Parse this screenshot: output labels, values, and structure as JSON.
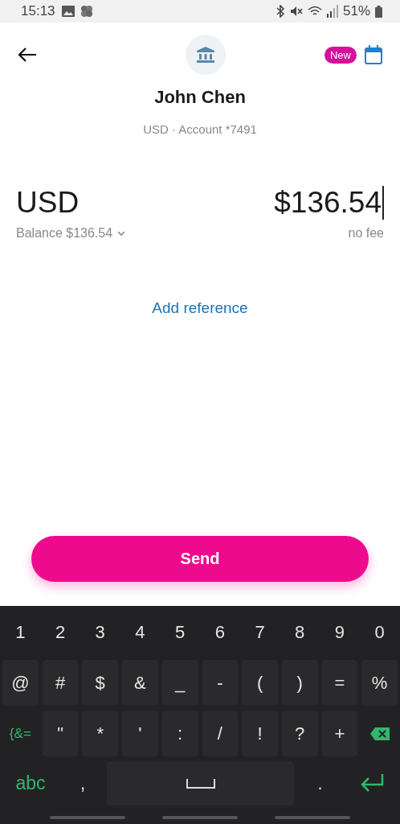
{
  "status_bar": {
    "time": "15:13",
    "battery": "51%"
  },
  "header": {
    "badge": "New"
  },
  "recipient": {
    "name": "John Chen",
    "account": "USD · Account *7491"
  },
  "amount": {
    "currency": "USD",
    "value": "$136.54",
    "balance": "Balance $136.54",
    "fee": "no fee"
  },
  "add_reference": "Add reference",
  "send_button": "Send",
  "keyboard": {
    "rows": [
      [
        {
          "kind": "plain",
          "label": "1"
        },
        {
          "kind": "plain",
          "label": "2"
        },
        {
          "kind": "plain",
          "label": "3"
        },
        {
          "kind": "plain",
          "label": "4"
        },
        {
          "kind": "plain",
          "label": "5"
        },
        {
          "kind": "plain",
          "label": "6"
        },
        {
          "kind": "plain",
          "label": "7"
        },
        {
          "kind": "plain",
          "label": "8"
        },
        {
          "kind": "plain",
          "label": "9"
        },
        {
          "kind": "plain",
          "label": "0"
        }
      ],
      [
        {
          "kind": "key",
          "label": "@"
        },
        {
          "kind": "key",
          "label": "#"
        },
        {
          "kind": "key",
          "label": "$"
        },
        {
          "kind": "key",
          "label": "&"
        },
        {
          "kind": "key",
          "label": "_"
        },
        {
          "kind": "key",
          "label": "-"
        },
        {
          "kind": "key",
          "label": "("
        },
        {
          "kind": "key",
          "label": ")"
        },
        {
          "kind": "key",
          "label": "="
        },
        {
          "kind": "key",
          "label": "%"
        }
      ],
      [
        {
          "kind": "mode",
          "label": "{&="
        },
        {
          "kind": "key",
          "label": "\""
        },
        {
          "kind": "key",
          "label": "*"
        },
        {
          "kind": "key",
          "label": "'"
        },
        {
          "kind": "key",
          "label": ":"
        },
        {
          "kind": "key",
          "label": "/"
        },
        {
          "kind": "key",
          "label": "!"
        },
        {
          "kind": "key",
          "label": "?"
        },
        {
          "kind": "key",
          "label": "+"
        },
        {
          "kind": "backspace"
        }
      ],
      [
        {
          "kind": "mode",
          "label": "abc"
        },
        {
          "kind": "plain",
          "label": ","
        },
        {
          "kind": "space"
        },
        {
          "kind": "plain",
          "label": "."
        },
        {
          "kind": "enter"
        }
      ]
    ]
  }
}
